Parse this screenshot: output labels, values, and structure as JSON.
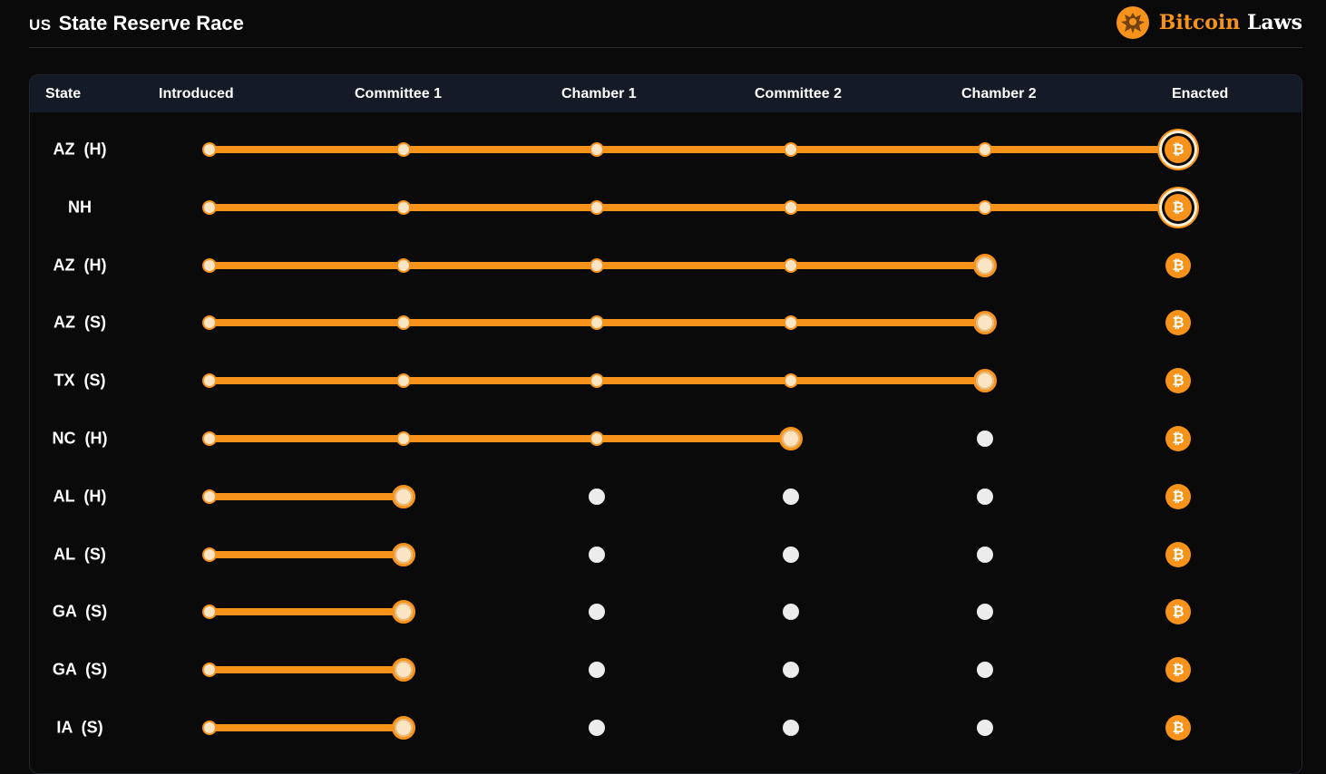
{
  "header": {
    "flag_code": "US",
    "title": "State Reserve Race",
    "logo_bitcoin": "Bitcoin",
    "logo_laws": "Laws"
  },
  "table": {
    "columns": [
      "State",
      "Introduced",
      "Committee 1",
      "Chamber 1",
      "Committee 2",
      "Chamber 2",
      "Enacted"
    ],
    "enacted_symbol": "₿",
    "rows": [
      {
        "state": "AZ  (H)",
        "stage": 5,
        "stage_name": "Enacted"
      },
      {
        "state": "NH",
        "stage": 5,
        "stage_name": "Enacted"
      },
      {
        "state": "AZ  (H)",
        "stage": 4,
        "stage_name": "Chamber 2"
      },
      {
        "state": "AZ  (S)",
        "stage": 4,
        "stage_name": "Chamber 2"
      },
      {
        "state": "TX  (S)",
        "stage": 4,
        "stage_name": "Chamber 2"
      },
      {
        "state": "NC  (H)",
        "stage": 3,
        "stage_name": "Committee 2"
      },
      {
        "state": "AL  (H)",
        "stage": 1,
        "stage_name": "Committee 1"
      },
      {
        "state": "AL  (S)",
        "stage": 1,
        "stage_name": "Committee 1"
      },
      {
        "state": "GA  (S)",
        "stage": 1,
        "stage_name": "Committee 1"
      },
      {
        "state": "GA  (S)",
        "stage": 1,
        "stage_name": "Committee 1"
      },
      {
        "state": "IA  (S)",
        "stage": 1,
        "stage_name": "Committee 1"
      }
    ]
  },
  "colors": {
    "accent": "#f7931a",
    "header_bg": "#141a26",
    "page_bg": "#0a0a0b",
    "pending_dot": "#ececec"
  }
}
